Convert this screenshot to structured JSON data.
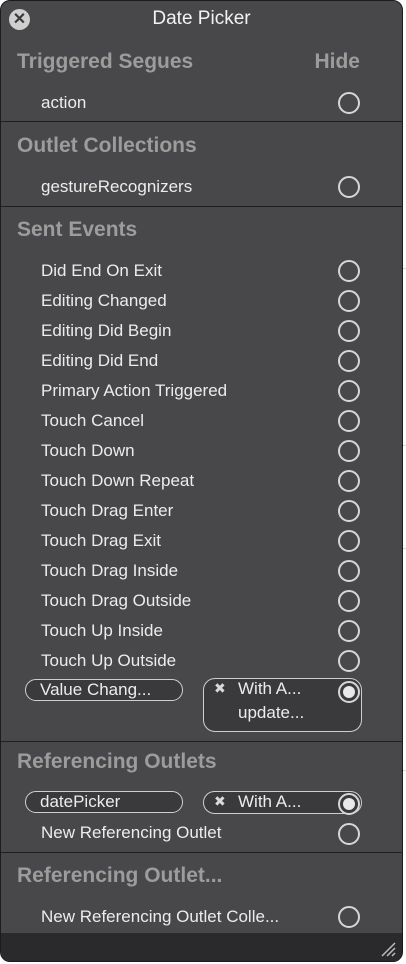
{
  "window": {
    "title": "Date Picker",
    "hide_label": "Hide"
  },
  "sections": {
    "triggered": "Triggered Segues",
    "outlet_collections": "Outlet Collections",
    "sent_events": "Sent Events",
    "referencing_outlets": "Referencing Outlets",
    "referencing_outlet_collections": "Referencing Outlet..."
  },
  "triggered_items": [
    "action"
  ],
  "outlet_collection_items": [
    "gestureRecognizers"
  ],
  "sent_events": [
    "Did End On Exit",
    "Editing Changed",
    "Editing Did Begin",
    "Editing Did End",
    "Primary Action Triggered",
    "Touch Cancel",
    "Touch Down",
    "Touch Down Repeat",
    "Touch Drag Enter",
    "Touch Drag Exit",
    "Touch Drag Inside",
    "Touch Drag Outside",
    "Touch Up Inside",
    "Touch Up Outside"
  ],
  "value_changed": {
    "label": "Value Chang...",
    "conn_line1": "With A...",
    "conn_line2": "update..."
  },
  "referencing": {
    "date_picker_label": "datePicker",
    "conn_line1": "With A...",
    "new_outlet": "New Referencing Outlet"
  },
  "referencing_collections": {
    "new_collection": "New Referencing Outlet Colle..."
  },
  "icons": {
    "close": "close-icon",
    "x": "remove-connection-icon",
    "resize": "resize-handle-icon"
  },
  "colors": {
    "panel": "#3a3a3c",
    "text": "#ececec",
    "header": "#9c9c9c"
  }
}
